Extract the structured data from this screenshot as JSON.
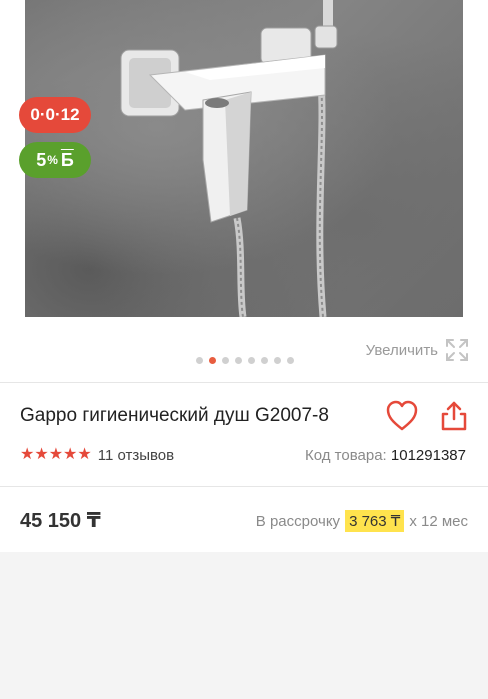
{
  "badges": {
    "installment": "0·0·12",
    "bonus_value": "5",
    "bonus_unit": "%",
    "bonus_letter": "Б"
  },
  "gallery": {
    "total_images": 8,
    "active_index": 1,
    "zoom_label": "Увеличить"
  },
  "product": {
    "title": "Gappo гигиенический душ G2007-8",
    "rating": 5,
    "reviews": "11 отзывов",
    "sku_label": "Код товара:",
    "sku_value": "101291387"
  },
  "pricing": {
    "price": "45 150 ₸",
    "installment_prefix": "В рассрочку",
    "installment_amount": "3 763 ₸",
    "installment_suffix": "x 12 мес"
  },
  "colors": {
    "accent": "#e5493a",
    "bonus": "#5aa02c",
    "highlight": "#ffe34d"
  }
}
